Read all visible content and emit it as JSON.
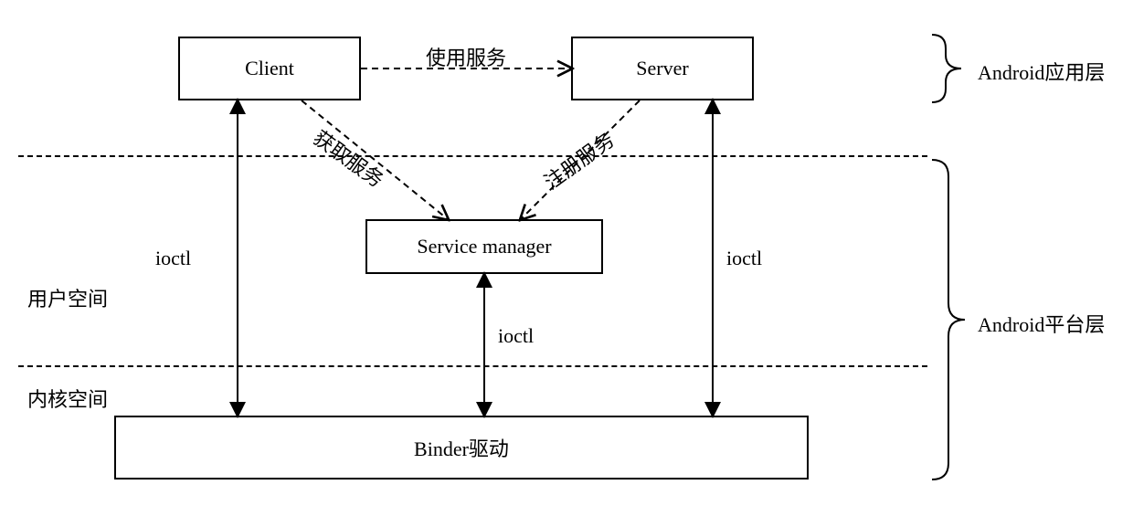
{
  "boxes": {
    "client": "Client",
    "server": "Server",
    "service_manager": "Service manager",
    "binder_driver": "Binder驱动"
  },
  "edges": {
    "use_service": "使用服务",
    "get_service": "获取服务",
    "register_service": "注册服务",
    "ioctl_left": "ioctl",
    "ioctl_mid": "ioctl",
    "ioctl_right": "ioctl"
  },
  "regions": {
    "user_space": "用户空间",
    "kernel_space": "内核空间"
  },
  "layers": {
    "app_layer": "Android应用层",
    "platform_layer": "Android平台层"
  }
}
